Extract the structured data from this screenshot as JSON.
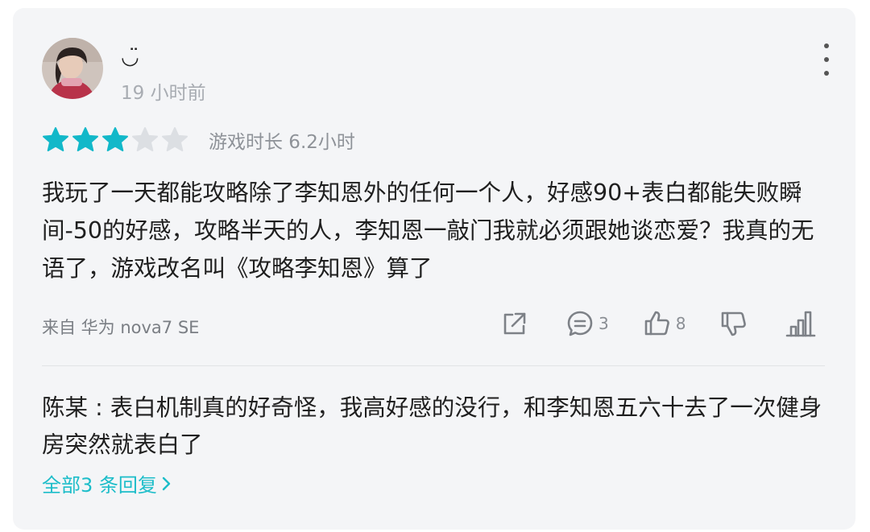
{
  "review": {
    "username": "◡̈",
    "time": "19 小时前",
    "rating": 3,
    "max_rating": 5,
    "playtime": "游戏时长 6.2小时",
    "body": "我玩了一天都能攻略除了李知恩外的任何一个人，好感90+表白都能失败瞬间-50的好感，攻略半天的人，李知恩一敲门我就必须跟她谈恋爱？我真的无语了，游戏改名叫《攻略李知恩》算了",
    "device": "来自 华为 nova7 SE",
    "comment_count": "3",
    "like_count": "8"
  },
  "reply": {
    "author": "陈某",
    "separator": " : ",
    "text": "表白机制真的好奇怪，我高好感的没行，和李知恩五六十去了一次健身房突然就表白了"
  },
  "all_replies_label": "全部3 条回复",
  "icons": [
    "more-vertical-icon",
    "star-icon",
    "share-icon",
    "comment-icon",
    "thumbs-up-icon",
    "thumbs-down-icon",
    "chart-icon",
    "chevron-right-icon"
  ],
  "colors": {
    "star_filled": "#12b8c9",
    "star_empty": "#dcdfe3",
    "accent_link": "#1cbdc9",
    "card_bg": "#f4f5f7"
  }
}
